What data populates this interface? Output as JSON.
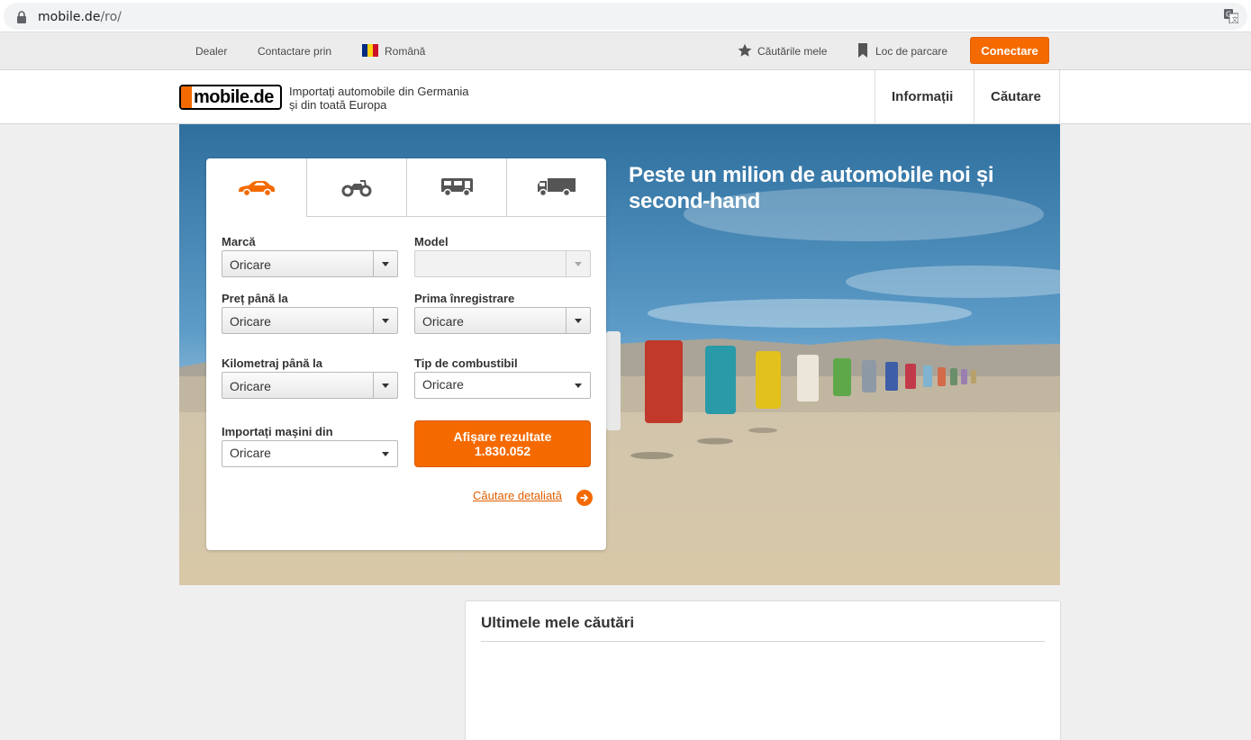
{
  "browser": {
    "url_host": "mobile.de",
    "url_path": "/ro/",
    "icons": [
      "lock-icon",
      "translate-icon"
    ]
  },
  "utility_bar": {
    "dealer": "Dealer",
    "contact": "Contactare prin",
    "language": "Română",
    "saved_searches": "Căutările mele",
    "parking": "Loc de parcare",
    "login": "Conectare"
  },
  "header": {
    "logo_text": "mobile.de",
    "tagline": "Importați automobile din Germania și din toată Europa",
    "nav": [
      "Informații",
      "Căutare"
    ]
  },
  "hero": {
    "headline": "Peste un milion de automobile noi și second-hand"
  },
  "search": {
    "tabs": [
      {
        "icon": "car-icon",
        "active": true
      },
      {
        "icon": "motorbike-icon",
        "active": false
      },
      {
        "icon": "motorhome-icon",
        "active": false
      },
      {
        "icon": "truck-icon",
        "active": false
      }
    ],
    "fields": {
      "make": {
        "label": "Marcă",
        "value": "Oricare"
      },
      "model": {
        "label": "Model",
        "value": ""
      },
      "price": {
        "label": "Preț până la",
        "value": "Oricare"
      },
      "registration": {
        "label": "Prima înregistrare",
        "value": "Oricare"
      },
      "mileage": {
        "label": "Kilometraj până la",
        "value": "Oricare"
      },
      "fuel": {
        "label": "Tip de combustibil",
        "value": "Oricare"
      },
      "import_from": {
        "label": "Importați mașini din",
        "value": "Oricare"
      }
    },
    "results_button": {
      "line1": "Afișare rezultate",
      "line2": "1.830.052"
    },
    "detail_link": "Căutare detaliată"
  },
  "recent": {
    "title": "Ultimele mele căutări"
  },
  "colors": {
    "accent": "#f56a00",
    "background": "#efefef"
  }
}
